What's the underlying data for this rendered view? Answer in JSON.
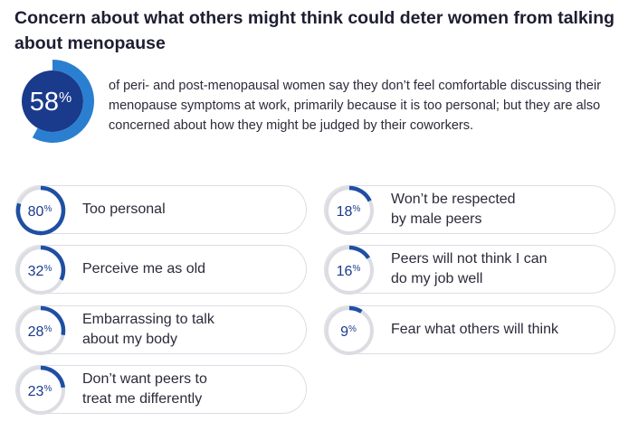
{
  "title": "Concern about what others might think could deter women from talking about menopause",
  "hero": {
    "value": 58,
    "number": "58",
    "unit": "%",
    "text": "of peri- and post-menopausal women say they don’t feel comfortable discussing their menopause symptoms at work, primarily because it is too personal; but they are also concerned about how they might be judged by their coworkers."
  },
  "colors": {
    "accent": "#1f4fa3",
    "accent_light": "#2b7fd0",
    "track": "#dcdde3",
    "hero_dark": "#1a3a8c"
  },
  "chart_data": {
    "type": "bar",
    "categories": [
      "Too personal",
      "Perceive me as old",
      "Embarrassing to talk about my body",
      "Don’t want peers to treat me differently",
      "Won’t be respected by male peers",
      "Peers will not think I can do my job well",
      "Fear what others will think"
    ],
    "values": [
      80,
      32,
      28,
      23,
      18,
      16,
      9
    ],
    "unit": "%"
  },
  "items": [
    {
      "pct": "80",
      "label": "Too personal"
    },
    {
      "pct": "32",
      "label": "Perceive me as old"
    },
    {
      "pct": "28",
      "label": "Embarrassing to talk\nabout my body"
    },
    {
      "pct": "23",
      "label": "Don’t want peers to\ntreat me differently"
    },
    {
      "pct": "18",
      "label": "Won’t be respected\nby male peers"
    },
    {
      "pct": "16",
      "label": "Peers will not think I can\ndo my job well"
    },
    {
      "pct": "9",
      "label": "Fear what others will think"
    }
  ]
}
